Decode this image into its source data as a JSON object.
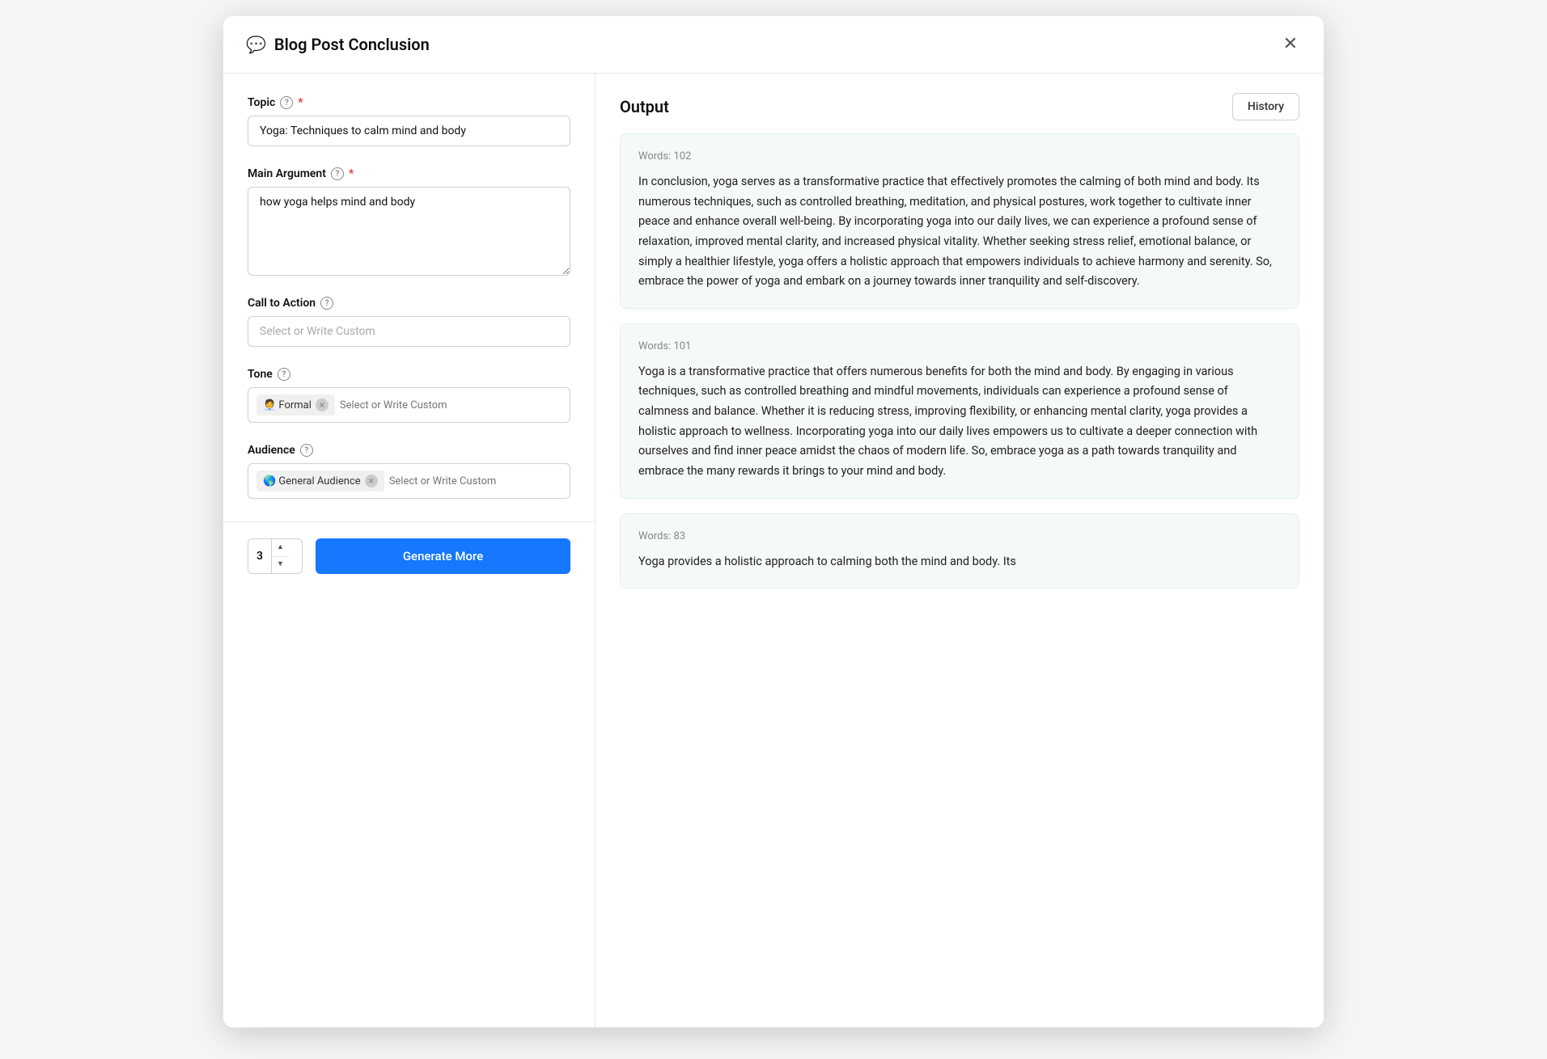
{
  "modal": {
    "title": "Blog Post Conclusion",
    "icon": "💬",
    "close_label": "✕"
  },
  "left": {
    "topic_label": "Topic",
    "topic_value": "Yoga: Techniques to calm mind and body",
    "main_argument_label": "Main Argument",
    "main_argument_value": "how yoga helps mind and body",
    "call_to_action_label": "Call to Action",
    "call_to_action_placeholder": "Select or Write Custom",
    "tone_label": "Tone",
    "tone_tag": "🧑‍💼 Formal",
    "tone_placeholder": "Select or Write Custom",
    "audience_label": "Audience",
    "audience_tag": "🌎 General Audience",
    "audience_placeholder": "Select or Write Custom"
  },
  "bottom": {
    "count_value": "3",
    "generate_label": "Generate More"
  },
  "output": {
    "title": "Output",
    "history_label": "History",
    "cards": [
      {
        "words": "Words: 102",
        "text": "In conclusion, yoga serves as a transformative practice that effectively promotes the calming of both mind and body. Its numerous techniques, such as controlled breathing, meditation, and physical postures, work together to cultivate inner peace and enhance overall well-being. By incorporating yoga into our daily lives, we can experience a profound sense of relaxation, improved mental clarity, and increased physical vitality. Whether seeking stress relief, emotional balance, or simply a healthier lifestyle, yoga offers a holistic approach that empowers individuals to achieve harmony and serenity. So, embrace the power of yoga and embark on a journey towards inner tranquility and self-discovery."
      },
      {
        "words": "Words: 101",
        "text": "Yoga is a transformative practice that offers numerous benefits for both the mind and body. By engaging in various techniques, such as controlled breathing and mindful movements, individuals can experience a profound sense of calmness and balance. Whether it is reducing stress, improving flexibility, or enhancing mental clarity, yoga provides a holistic approach to wellness. Incorporating yoga into our daily lives empowers us to cultivate a deeper connection with ourselves and find inner peace amidst the chaos of modern life. So, embrace yoga as a path towards tranquility and embrace the many rewards it brings to your mind and body."
      },
      {
        "words": "Words: 83",
        "text": "Yoga provides a holistic approach to calming both the mind and body. Its"
      }
    ]
  }
}
